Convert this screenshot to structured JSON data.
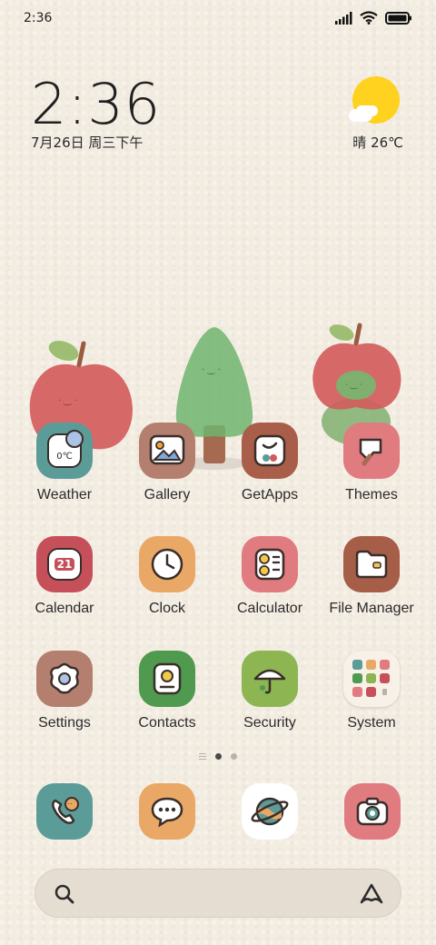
{
  "status_bar": {
    "time": "2:36",
    "icons": [
      "signal-icon",
      "wifi-icon",
      "battery-icon"
    ]
  },
  "clock_widget": {
    "time": "2:36",
    "date": "7月26日 周三下午"
  },
  "weather_widget": {
    "condition": "晴",
    "temperature": "26℃",
    "icon": "sun-cloud-icon"
  },
  "apps": [
    {
      "label": "Weather",
      "icon": "weather-icon",
      "color": "#5b9b98",
      "temp_badge": "0℃"
    },
    {
      "label": "Gallery",
      "icon": "gallery-icon",
      "color": "#b47f6e"
    },
    {
      "label": "GetApps",
      "icon": "getapps-icon",
      "color": "#a95e49"
    },
    {
      "label": "Themes",
      "icon": "themes-icon",
      "color": "#e07b80"
    },
    {
      "label": "Calendar",
      "icon": "calendar-icon",
      "color": "#c6505a",
      "day_badge": "21"
    },
    {
      "label": "Clock",
      "icon": "clock-icon",
      "color": "#eaa866"
    },
    {
      "label": "Calculator",
      "icon": "calculator-icon",
      "color": "#e07b80"
    },
    {
      "label": "File Manager",
      "icon": "folder-icon",
      "color": "#a65e48"
    },
    {
      "label": "Settings",
      "icon": "settings-icon",
      "color": "#b47f6e"
    },
    {
      "label": "Contacts",
      "icon": "contacts-icon",
      "color": "#4f9a4e"
    },
    {
      "label": "Security",
      "icon": "security-icon",
      "color": "#8db552"
    },
    {
      "label": "System",
      "icon": "system-folder-icon",
      "color": "#f7f1e8"
    }
  ],
  "page_indicator": {
    "pages": 2,
    "current": 1
  },
  "dock": [
    {
      "name": "phone",
      "icon": "phone-icon",
      "color": "#5b9b98"
    },
    {
      "name": "messages",
      "icon": "messages-icon",
      "color": "#eaa866"
    },
    {
      "name": "browser",
      "icon": "browser-planet-icon",
      "color": "#ffffff"
    },
    {
      "name": "camera",
      "icon": "camera-icon",
      "color": "#e07b80"
    }
  ],
  "search_bar": {
    "icon_left": "search-icon",
    "icon_right": "assistant-icon"
  }
}
